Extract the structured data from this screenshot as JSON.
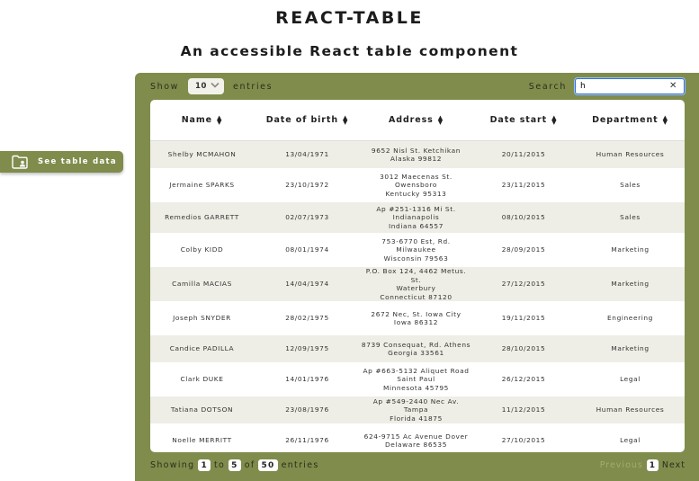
{
  "header": {
    "title": "REACT-TABLE",
    "subtitle": "An accessible React table component"
  },
  "sidebar": {
    "see_data_label": "See table data",
    "icon": "folder-user-icon"
  },
  "controls": {
    "show_label": "Show",
    "entries_value": "10",
    "entries_label": "entries",
    "search_label": "Search",
    "search_value": "h",
    "clear_icon": "✕"
  },
  "table": {
    "columns": [
      "Name",
      "Date of birth",
      "Address",
      "Date start",
      "Department"
    ],
    "rows": [
      {
        "name": "Shelby MCMAHON",
        "dob": "13/04/1971",
        "address": [
          "9652 Nisl St. Ketchikan",
          "Alaska 99812"
        ],
        "start": "20/11/2015",
        "dept": "Human Resources"
      },
      {
        "name": "Jermaine SPARKS",
        "dob": "23/10/1972",
        "address": [
          "3012 Maecenas St. Owensboro",
          "Kentucky 95313"
        ],
        "start": "23/11/2015",
        "dept": "Sales"
      },
      {
        "name": "Remedios GARRETT",
        "dob": "02/07/1973",
        "address": [
          "Ap #251-1316 Mi St.",
          "Indianapolis",
          "Indiana 64557"
        ],
        "start": "08/10/2015",
        "dept": "Sales"
      },
      {
        "name": "Colby KIDD",
        "dob": "08/01/1974",
        "address": [
          "753-6770 Est, Rd. Milwaukee",
          "Wisconsin 79563"
        ],
        "start": "28/09/2015",
        "dept": "Marketing"
      },
      {
        "name": "Camilla MACIAS",
        "dob": "14/04/1974",
        "address": [
          "P.O. Box 124, 4462 Metus. St.",
          "Waterbury",
          "Connecticut 87120"
        ],
        "start": "27/12/2015",
        "dept": "Marketing"
      },
      {
        "name": "Joseph SNYDER",
        "dob": "28/02/1975",
        "address": [
          "2672 Nec, St. Iowa City",
          "Iowa 86312"
        ],
        "start": "19/11/2015",
        "dept": "Engineering"
      },
      {
        "name": "Candice PADILLA",
        "dob": "12/09/1975",
        "address": [
          "8739 Consequat, Rd. Athens",
          "Georgia 33561"
        ],
        "start": "28/10/2015",
        "dept": "Marketing"
      },
      {
        "name": "Clark DUKE",
        "dob": "14/01/1976",
        "address": [
          "Ap #663-5132 Aliquet Road",
          "Saint Paul",
          "Minnesota 45795"
        ],
        "start": "26/12/2015",
        "dept": "Legal"
      },
      {
        "name": "Tatiana DOTSON",
        "dob": "23/08/1976",
        "address": [
          "Ap #549-2440 Nec Av. Tampa",
          "Florida 41875"
        ],
        "start": "11/12/2015",
        "dept": "Human Resources"
      },
      {
        "name": "Noelle MERRITT",
        "dob": "26/11/1976",
        "address": [
          "624-9715 Ac Avenue Dover",
          "Delaware 86535"
        ],
        "start": "27/10/2015",
        "dept": "Legal"
      }
    ]
  },
  "footer": {
    "showing_label": "Showing",
    "from": "1",
    "to_label": "to",
    "to": "5",
    "of_label": "of",
    "total": "50",
    "entries_label": "entries",
    "previous_label": "Previous",
    "current_page": "1",
    "next_label": "Next"
  },
  "colors": {
    "panel": "#7f8c4c",
    "row_stripe": "#eeeee6",
    "disabled_text": "#a2ad6e"
  }
}
